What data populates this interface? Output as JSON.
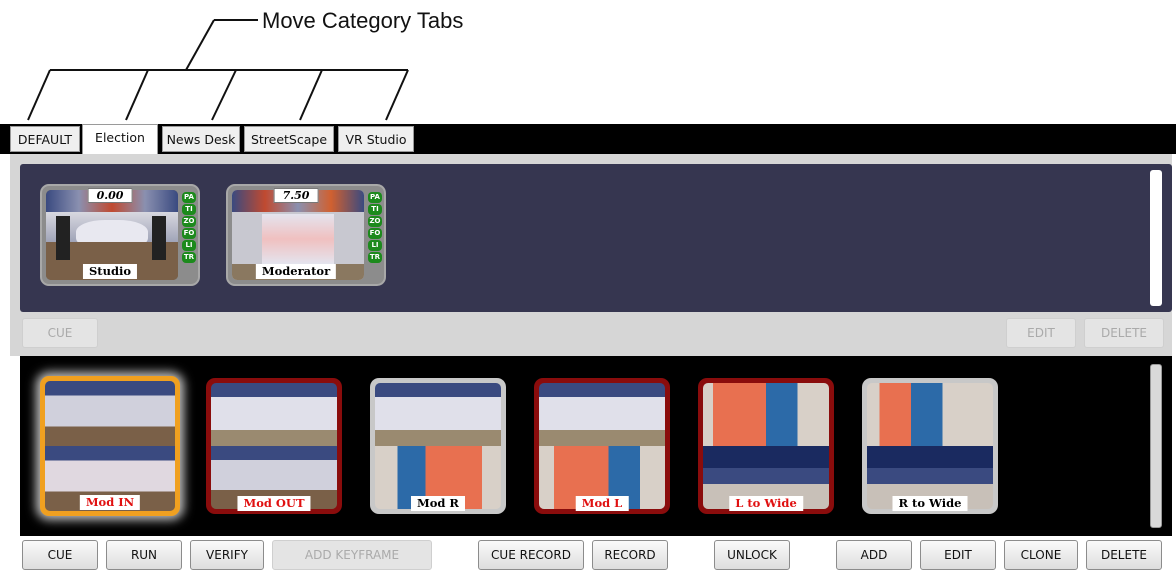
{
  "annotation": {
    "label": "Move Category Tabs"
  },
  "tabs": [
    {
      "label": "DEFAULT",
      "active": false
    },
    {
      "label": "Election",
      "active": true
    },
    {
      "label": "News Desk",
      "active": false
    },
    {
      "label": "StreetScape",
      "active": false
    },
    {
      "label": "VR Studio",
      "active": false
    }
  ],
  "top_panel": {
    "thumbnails": [
      {
        "label": "Studio",
        "time": "0.00",
        "chips": [
          "PA",
          "TI",
          "ZO",
          "FO",
          "LI",
          "TR"
        ]
      },
      {
        "label": "Moderator",
        "time": "7.50",
        "chips": [
          "PA",
          "TI",
          "ZO",
          "FO",
          "LI",
          "TR"
        ]
      }
    ],
    "cue_label": "CUE",
    "edit_label": "EDIT",
    "delete_label": "DELETE"
  },
  "bottom_panel": {
    "thumbnails": [
      {
        "label": "Mod IN",
        "label_color": "red",
        "border": "orange",
        "selected": true
      },
      {
        "label": "Mod OUT",
        "label_color": "red",
        "border": "darkred",
        "selected": false
      },
      {
        "label": "Mod R",
        "label_color": "black",
        "border": "gray",
        "selected": false
      },
      {
        "label": "Mod L",
        "label_color": "red",
        "border": "darkred",
        "selected": false
      },
      {
        "label": "L to Wide",
        "label_color": "red",
        "border": "darkred",
        "selected": false
      },
      {
        "label": "R to Wide",
        "label_color": "black",
        "border": "gray",
        "selected": false
      }
    ]
  },
  "buttons": {
    "cue": "CUE",
    "run": "RUN",
    "verify": "VERIFY",
    "add_keyframe": "ADD KEYFRAME",
    "cue_record": "CUE RECORD",
    "record": "RECORD",
    "unlock": "UNLOCK",
    "add": "ADD",
    "edit": "EDIT",
    "clone": "CLONE",
    "delete": "DELETE"
  },
  "colors": {
    "top_area_bg": "#363650",
    "selected_border": "#f0a020",
    "red_border": "#8a0c0c",
    "gray_border": "#c8c8c8",
    "chip_green": "#1c8a1c",
    "label_red": "#e01010"
  }
}
